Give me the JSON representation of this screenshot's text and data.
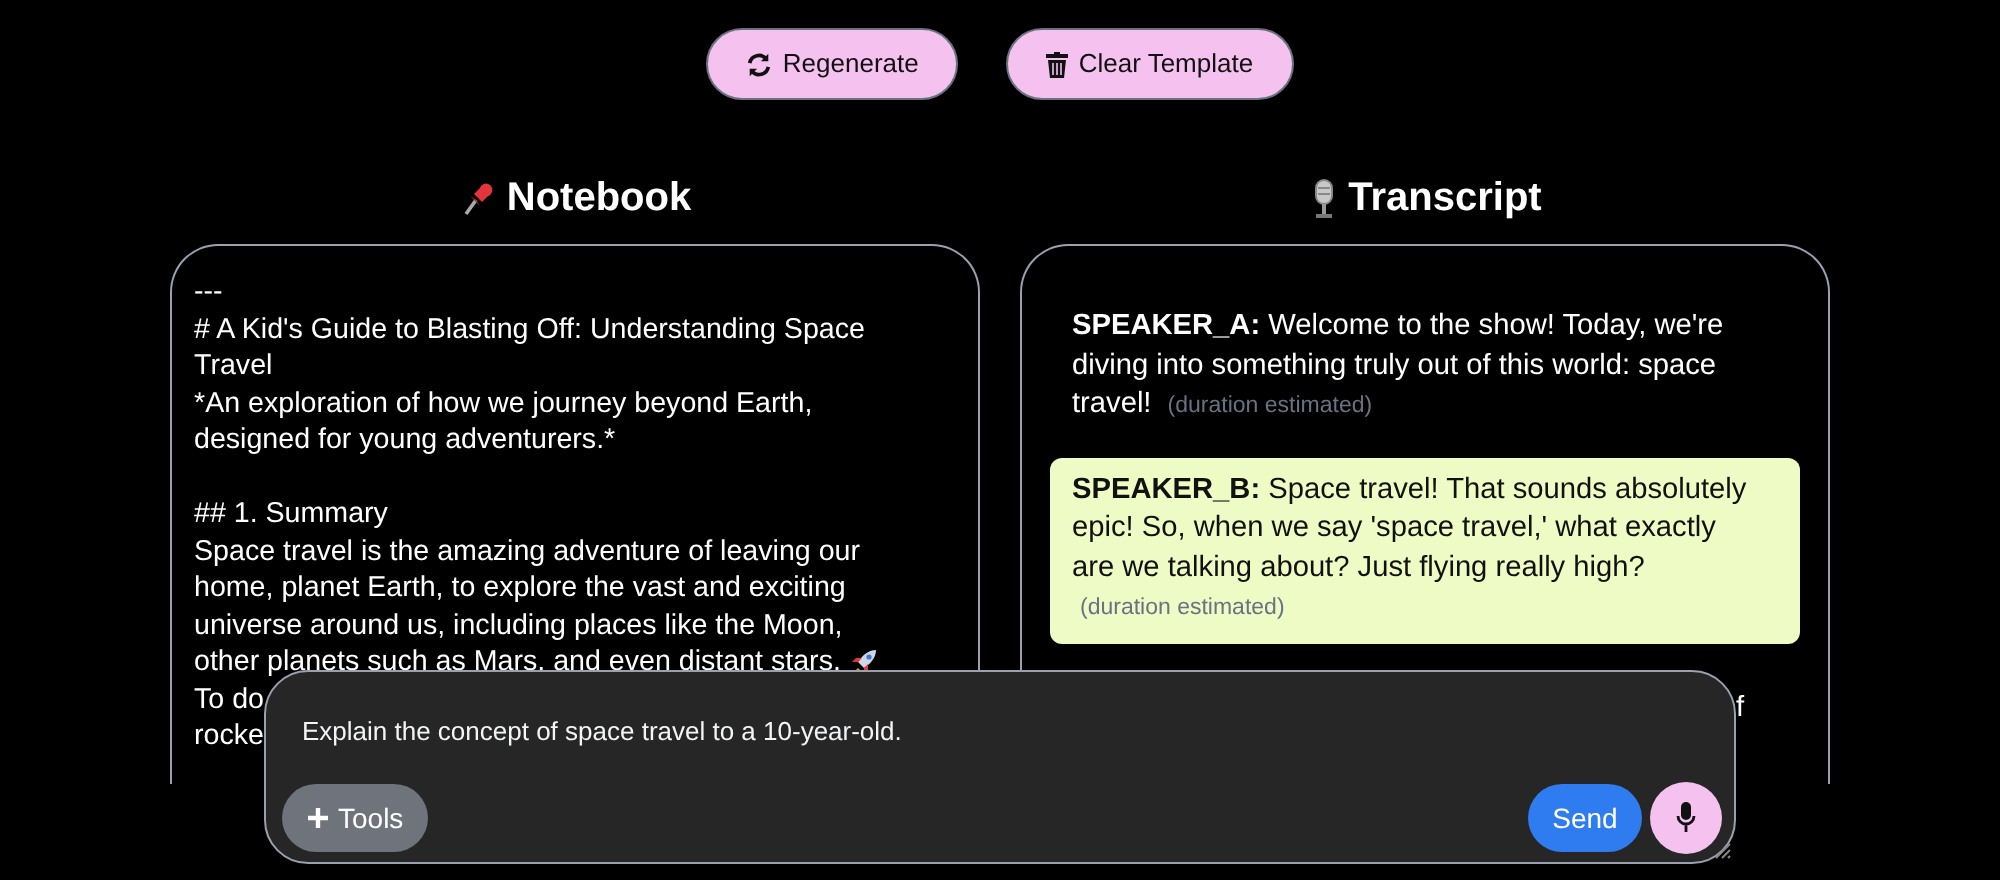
{
  "toolbar": {
    "buttons": [
      {
        "kind": "regenerate",
        "label": "Regenerate"
      },
      {
        "kind": "clear",
        "label": "Clear Template"
      }
    ]
  },
  "notebook": {
    "title": "Notebook",
    "paragraphs": [
      {
        "lines": [
          {
            "text": "---"
          },
          {
            "text": "# A Kid's Guide to Blasting Off: Understanding Space"
          },
          {
            "text": "Travel"
          },
          {
            "text": "*An exploration of how we journey beyond Earth,"
          },
          {
            "text": "designed for young adventurers.*"
          }
        ]
      },
      {
        "lines": [
          {
            "text": "## 1. Summary"
          },
          {
            "text": "Space travel is the amazing adventure of leaving our"
          },
          {
            "text": "home, planet Earth, to explore the vast and exciting"
          },
          {
            "text": "universe around us, including places like the Moon,"
          },
          {
            "text": "other planets such as Mars, and even distant stars.",
            "rocket": true
          },
          {
            "text": "To do"
          },
          {
            "text": "rocke"
          }
        ]
      }
    ]
  },
  "transcript": {
    "title": "Transcript",
    "entries": [
      {
        "speaker": "SPEAKER_A:",
        "text": "Welcome to the show! Today, we're diving into something truly out of this world: space travel!",
        "note": "(duration estimated)",
        "highlighted": false
      },
      {
        "speaker": "SPEAKER_B:",
        "text": "Space travel! That sounds absolutely epic! So, when we say 'space travel,' what exactly are we talking about? Just flying really high?",
        "note": "(duration estimated)",
        "highlighted": true
      }
    ],
    "partial_text": "f"
  },
  "composer": {
    "value": "Explain the concept of space travel to a 10-year-old.",
    "tools_label": "Tools",
    "send_label": "Send"
  }
}
